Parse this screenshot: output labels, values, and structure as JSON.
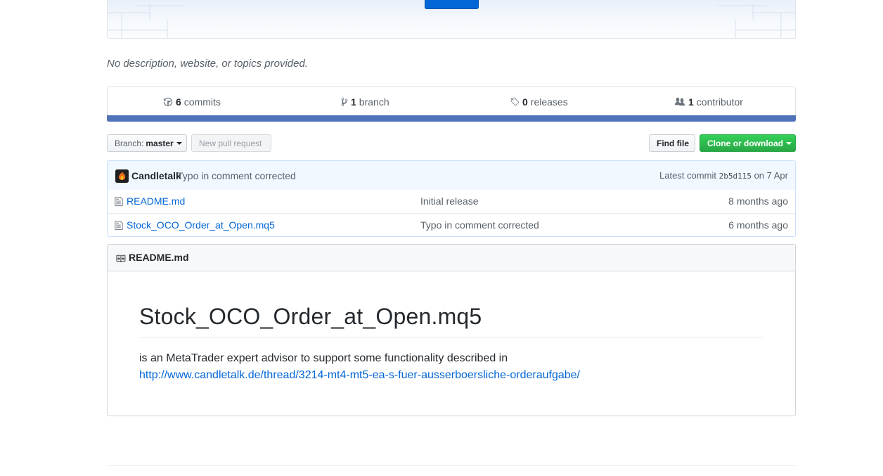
{
  "repo": {
    "description": "No description, website, or topics provided."
  },
  "summary": {
    "commits": {
      "count": "6",
      "label": "commits"
    },
    "branches": {
      "count": "1",
      "label": "branch"
    },
    "releases": {
      "count": "0",
      "label": "releases"
    },
    "contributors": {
      "count": "1",
      "label": "contributor"
    },
    "language_color": "#4f72b9"
  },
  "nav": {
    "branch_prefix": "Branch:",
    "branch_name": "master",
    "new_pull_request": "New pull request",
    "find_file": "Find file",
    "clone_or_download": "Clone or download"
  },
  "commit": {
    "author": "Candletalk",
    "message": "Typo in comment corrected",
    "latest_label": "Latest commit",
    "sha": "2b5d115",
    "date": "on 7 Apr"
  },
  "files": [
    {
      "name": "README.md",
      "message": "Initial release",
      "age": "8 months ago",
      "icon": "file-icon"
    },
    {
      "name": "Stock_OCO_Order_at_Open.mq5",
      "message": "Typo in comment corrected",
      "age": "6 months ago",
      "icon": "file-icon"
    }
  ],
  "readme": {
    "filename": "README.md",
    "heading": "Stock_OCO_Order_at_Open.mq5",
    "text": "is an MetaTrader expert advisor to support some functionality described in",
    "link": "http://www.candletalk.de/thread/3214-mt4-mt5-ea-s-fuer-ausserboersliche-orderaufgabe/"
  },
  "colors": {
    "accent": "#0366d6",
    "green_button": "#28a745",
    "commit_tease_bg": "#f1f8ff"
  }
}
